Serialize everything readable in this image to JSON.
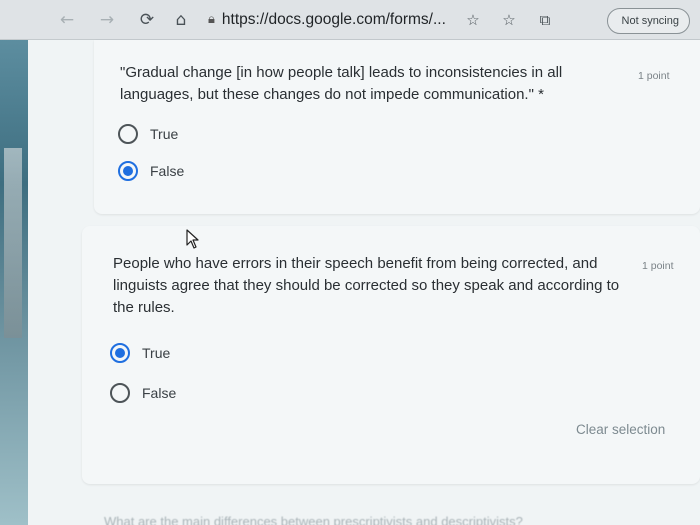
{
  "browser": {
    "url": "https://docs.google.com/forms/...",
    "sync_label": "Not syncing",
    "icons": [
      "back-icon",
      "forward-icon",
      "reload-icon",
      "home-icon",
      "lock-icon",
      "read-aloud-icon",
      "favorites-icon",
      "collections-icon",
      "profile-icon"
    ]
  },
  "questions": [
    {
      "text": "\"Gradual change [in how people talk] leads to inconsistencies in all languages, but these changes do not impede communication.\" *",
      "points": "1 point",
      "options": [
        {
          "label": "True",
          "selected": false
        },
        {
          "label": "False",
          "selected": true
        }
      ]
    },
    {
      "text": "People who have errors in their speech benefit from being corrected, and linguists agree that they should be corrected so they speak and according to the rules.",
      "points": "1 point",
      "options": [
        {
          "label": "True",
          "selected": true
        },
        {
          "label": "False",
          "selected": false
        }
      ],
      "clear_label": "Clear selection"
    }
  ],
  "next_question_partial": "What are the main differences between prescriptivists and descriptivists?",
  "colors": {
    "accent": "#1f6fe0",
    "page_bg": "#f0f4f5"
  }
}
